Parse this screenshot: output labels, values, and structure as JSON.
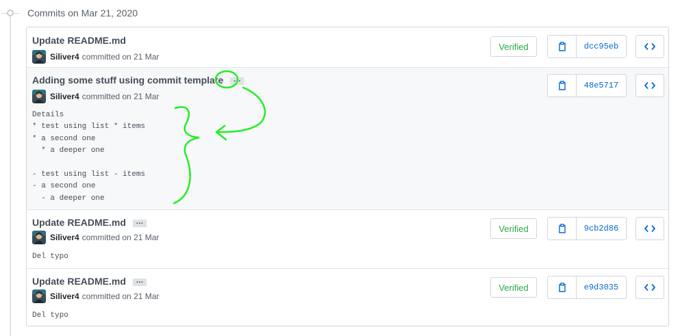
{
  "group": {
    "header": "Commits on Mar 21, 2020"
  },
  "colors": {
    "link": "#0366d6",
    "verified": "#28a745",
    "annotation": "#22ee22",
    "border": "#d1d5da"
  },
  "icons": {
    "clipboard": "clippy-icon",
    "browse": "code-icon",
    "ellipsis": "ellipsis-icon"
  },
  "commits": [
    {
      "message": "Update README.md",
      "author": "Siliver4",
      "date_text": "committed on 21 Mar",
      "verified": "Verified",
      "sha": "dcc95eb",
      "has_ellipsis": false,
      "description": ""
    },
    {
      "message": "Adding some stuff using commit template",
      "author": "Siliver4",
      "date_text": "committed on 21 Mar",
      "verified": "",
      "sha": "48e5717",
      "has_ellipsis": true,
      "expanded": true,
      "description": "Details\n* test using list * items\n* a second one\n  * a deeper one\n\n- test using list - items\n- a second one\n  - a deeper one"
    },
    {
      "message": "Update README.md",
      "author": "Siliver4",
      "date_text": "committed on 21 Mar",
      "verified": "Verified",
      "sha": "9cb2d86",
      "has_ellipsis": true,
      "description": "Del typo"
    },
    {
      "message": "Update README.md",
      "author": "Siliver4",
      "date_text": "committed on 21 Mar",
      "verified": "Verified",
      "sha": "e9d3035",
      "has_ellipsis": true,
      "description": "Del typo"
    }
  ]
}
